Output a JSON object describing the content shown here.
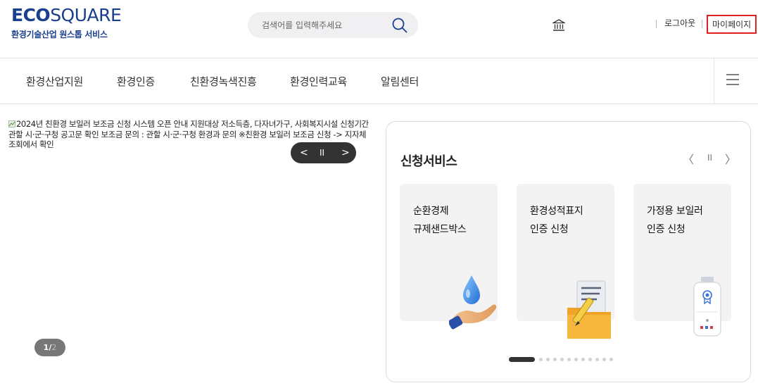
{
  "header": {
    "logo_eco": "ECO",
    "logo_square": "SQUARE",
    "logo_sub": "환경기술산업 원스톱 서비스",
    "search_placeholder": "검색어를 입력해주세요",
    "search_icon": "search-icon",
    "bank_icon": "bank-icon",
    "logout_label": "로그아웃",
    "mypage_label": "마이페이지",
    "accent_color": "#e0201c",
    "brand_color": "#1a3f8f"
  },
  "gnb": {
    "items": [
      {
        "label": "환경산업지원"
      },
      {
        "label": "환경인증"
      },
      {
        "label": "친환경녹색진흥"
      },
      {
        "label": "환경인력교육"
      },
      {
        "label": "알림센터"
      }
    ],
    "menu_icon": "hamburger-menu-icon"
  },
  "banner": {
    "alt_text": "2024년 친환경 보일러 보조금 신청 시스템 오픈 안내 지원대상 저소득층, 다자녀가구, 사회복지시설 신청기간 관할 시·군·구청 공고문 확인 보조금 문의 : 관할 시·군·구청 환경과 문의 ※친환경 보일러 보조금 신청 -> 지자체 조회에서 확인",
    "prev_label": "<",
    "pause_label": "II",
    "next_label": ">",
    "page_current": "1",
    "page_sep": "/",
    "page_total": "2"
  },
  "services": {
    "title": "신청서비스",
    "prev_label": "〈",
    "pause_label": "II",
    "next_label": "〉",
    "cards": [
      {
        "label": "순환경제\n규제샌드박스",
        "icon": "water-drop-hand-icon"
      },
      {
        "label": "환경성적표지\n인증 신청",
        "icon": "document-folder-pencil-icon"
      },
      {
        "label": "가정용 보일러\n인증 신청",
        "icon": "boiler-icon"
      }
    ],
    "pagination_dots": 12,
    "active_dot": 1
  }
}
